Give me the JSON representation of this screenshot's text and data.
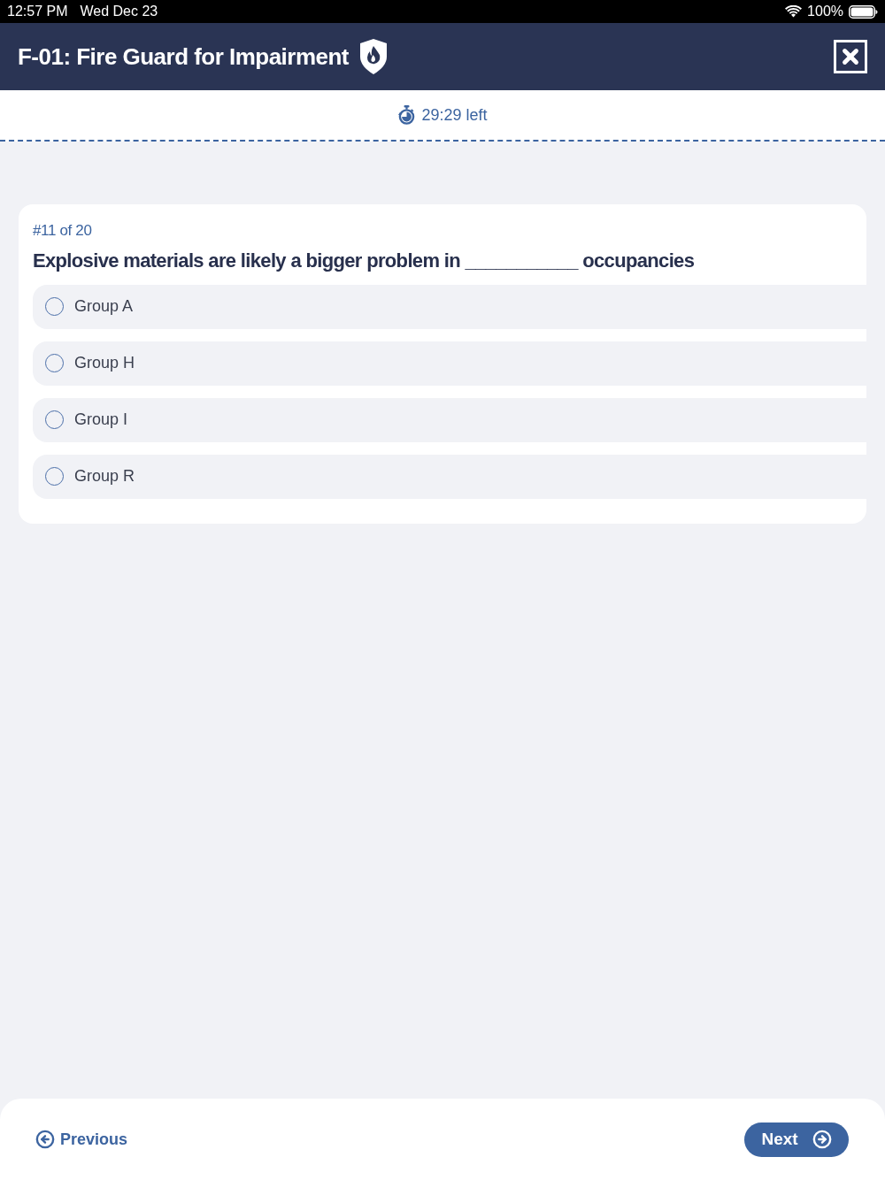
{
  "status_bar": {
    "time": "12:57 PM",
    "date": "Wed Dec 23",
    "battery": "100%"
  },
  "header": {
    "title": "F-01: Fire Guard for Impairment"
  },
  "timer": {
    "text": "29:29 left"
  },
  "question": {
    "counter": "#11 of 20",
    "text": "Explosive materials are likely a bigger problem in ___________ occupancies",
    "options": [
      {
        "label": "Group A",
        "selected": false
      },
      {
        "label": "Group H",
        "selected": false
      },
      {
        "label": "Group I",
        "selected": false
      },
      {
        "label": "Group R",
        "selected": false
      }
    ]
  },
  "footer": {
    "previous": "Previous",
    "next": "Next"
  }
}
